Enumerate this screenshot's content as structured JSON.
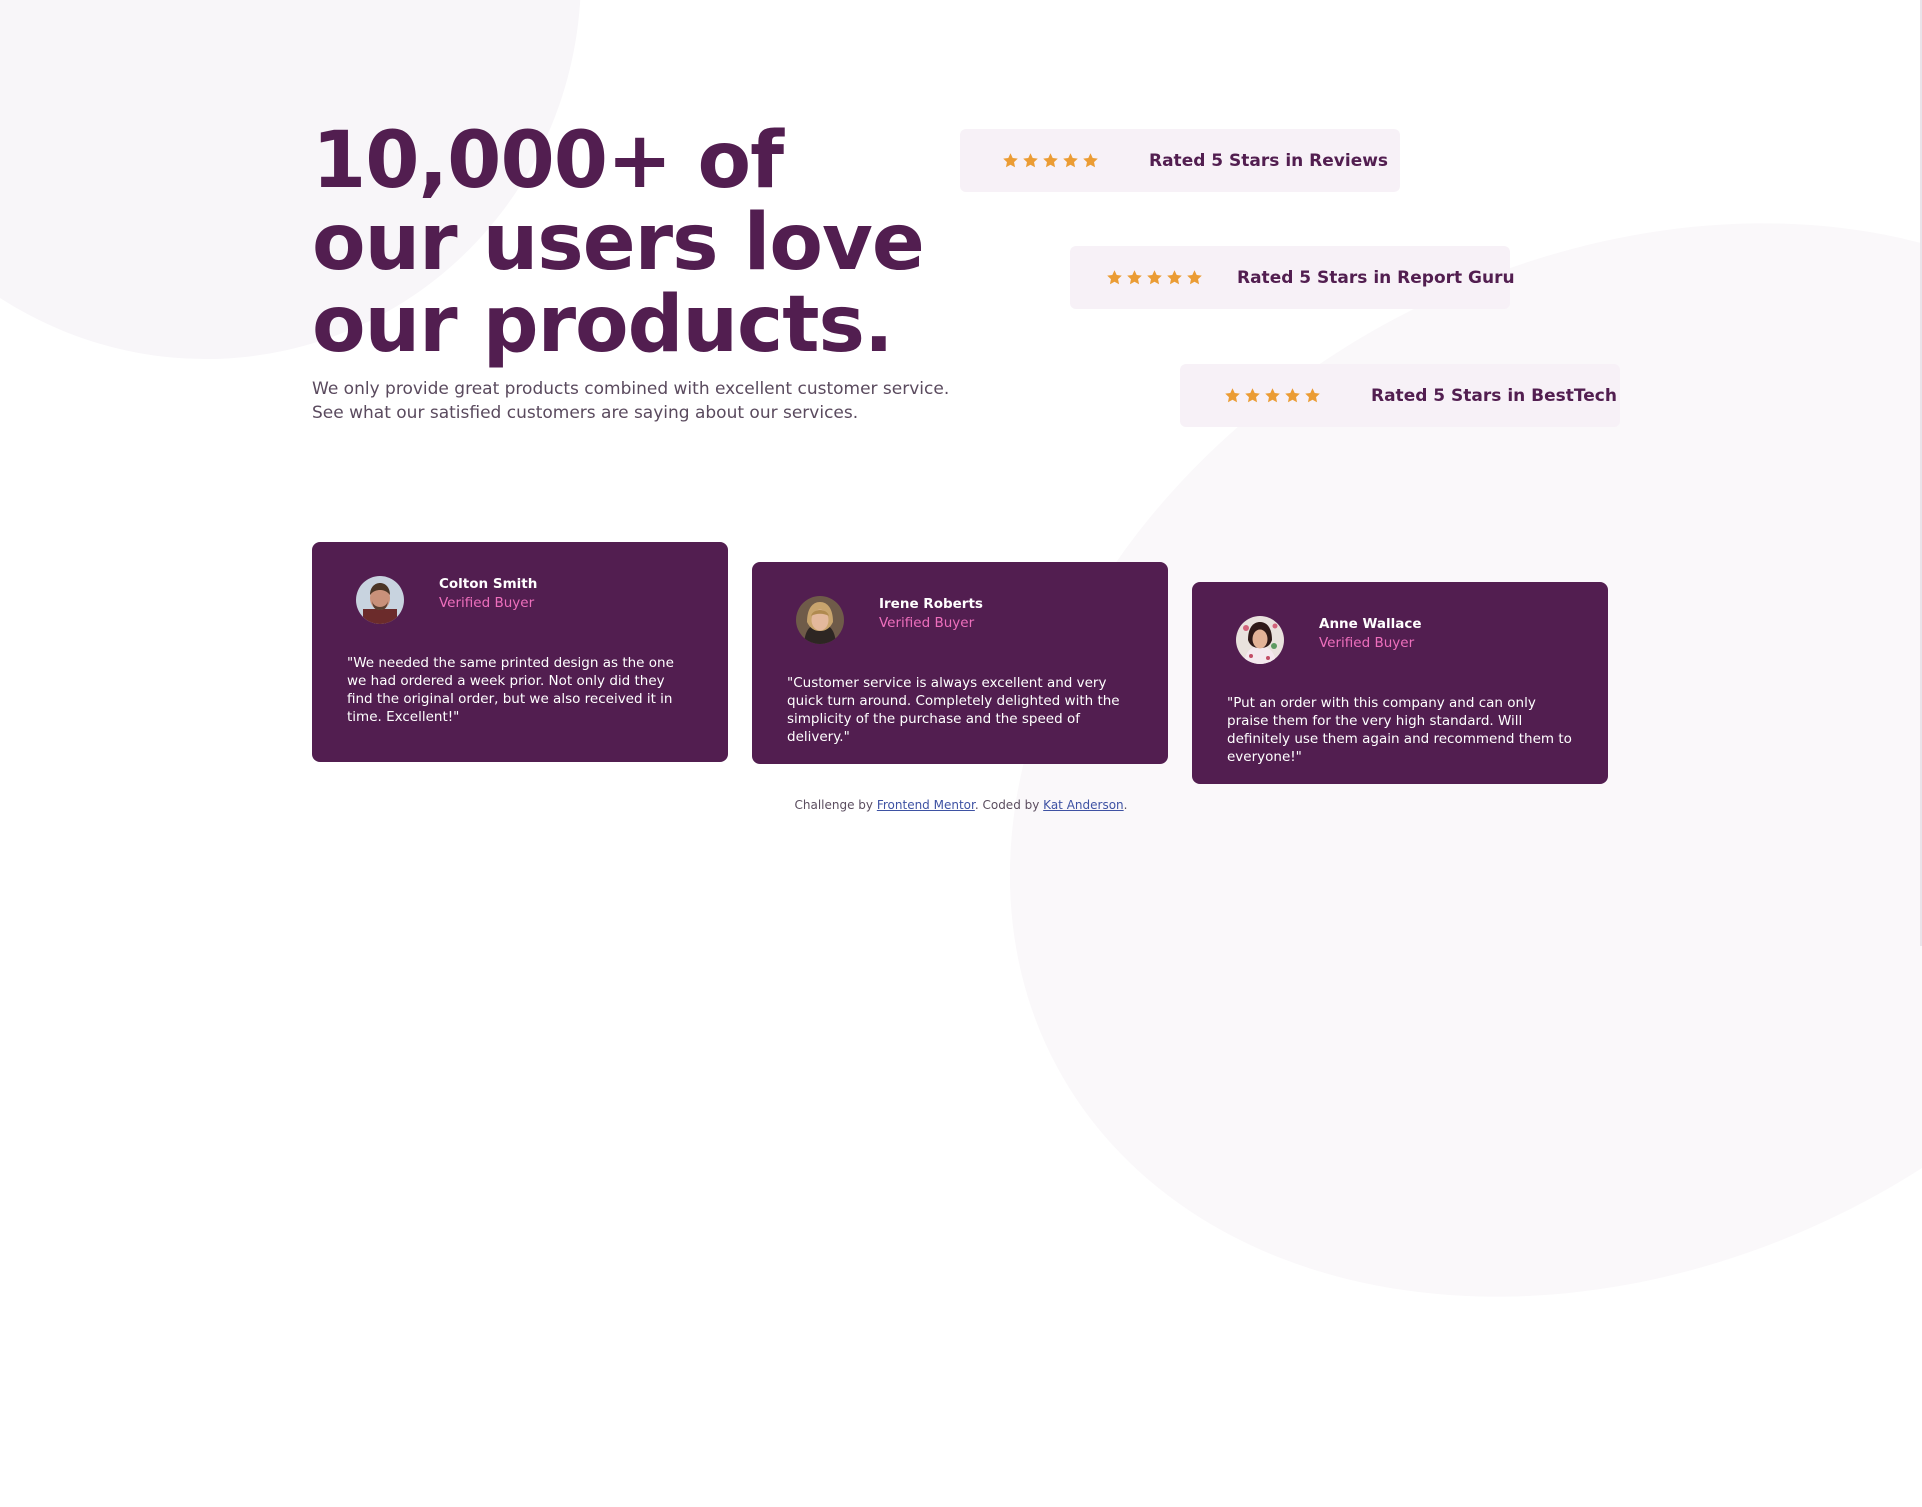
{
  "hero": {
    "title": "10,000+ of our users love our products.",
    "description": "We only provide great products combined with excellent customer service. See what our satisfied customers are saying about our services."
  },
  "ratings": [
    {
      "text": "Rated 5 Stars in Reviews",
      "stars": 5
    },
    {
      "text": "Rated 5 Stars in Report Guru",
      "stars": 5
    },
    {
      "text": "Rated 5 Stars in BestTech",
      "stars": 5
    }
  ],
  "testimonials": [
    {
      "name": "Colton Smith",
      "badge": "Verified Buyer",
      "quote": "\"We needed the same printed design as the one we had ordered a week prior. Not only did they find the original order, but we also received it in time. Excellent!\""
    },
    {
      "name": "Irene Roberts",
      "badge": "Verified Buyer",
      "quote": "\"Customer service is always excellent and very quick turn around. Completely delighted with the simplicity of the purchase and the speed of delivery.\""
    },
    {
      "name": "Anne Wallace",
      "badge": "Verified Buyer",
      "quote": "\"Put an order with this company and can only praise them for the very high standard. Will definitely use them again and recommend them to everyone!\""
    }
  ],
  "attribution": {
    "prefix": "Challenge by ",
    "link1": "Frontend Mentor",
    "middle": ". Coded by ",
    "link2": "Kat Anderson",
    "suffix": "."
  },
  "colors": {
    "primary": "#521e50",
    "accent": "#ee6fbd",
    "star": "#eb9c34",
    "rating_bg": "#f7f1f7"
  }
}
